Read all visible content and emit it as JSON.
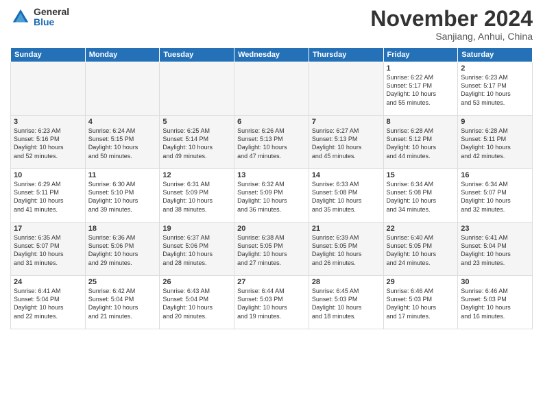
{
  "logo": {
    "general": "General",
    "blue": "Blue"
  },
  "title": "November 2024",
  "location": "Sanjiang, Anhui, China",
  "weekdays": [
    "Sunday",
    "Monday",
    "Tuesday",
    "Wednesday",
    "Thursday",
    "Friday",
    "Saturday"
  ],
  "weeks": [
    [
      {
        "day": "",
        "info": "",
        "empty": true
      },
      {
        "day": "",
        "info": "",
        "empty": true
      },
      {
        "day": "",
        "info": "",
        "empty": true
      },
      {
        "day": "",
        "info": "",
        "empty": true
      },
      {
        "day": "",
        "info": "",
        "empty": true
      },
      {
        "day": "1",
        "info": "Sunrise: 6:22 AM\nSunset: 5:17 PM\nDaylight: 10 hours\nand 55 minutes."
      },
      {
        "day": "2",
        "info": "Sunrise: 6:23 AM\nSunset: 5:17 PM\nDaylight: 10 hours\nand 53 minutes."
      }
    ],
    [
      {
        "day": "3",
        "info": "Sunrise: 6:23 AM\nSunset: 5:16 PM\nDaylight: 10 hours\nand 52 minutes."
      },
      {
        "day": "4",
        "info": "Sunrise: 6:24 AM\nSunset: 5:15 PM\nDaylight: 10 hours\nand 50 minutes."
      },
      {
        "day": "5",
        "info": "Sunrise: 6:25 AM\nSunset: 5:14 PM\nDaylight: 10 hours\nand 49 minutes."
      },
      {
        "day": "6",
        "info": "Sunrise: 6:26 AM\nSunset: 5:13 PM\nDaylight: 10 hours\nand 47 minutes."
      },
      {
        "day": "7",
        "info": "Sunrise: 6:27 AM\nSunset: 5:13 PM\nDaylight: 10 hours\nand 45 minutes."
      },
      {
        "day": "8",
        "info": "Sunrise: 6:28 AM\nSunset: 5:12 PM\nDaylight: 10 hours\nand 44 minutes."
      },
      {
        "day": "9",
        "info": "Sunrise: 6:28 AM\nSunset: 5:11 PM\nDaylight: 10 hours\nand 42 minutes."
      }
    ],
    [
      {
        "day": "10",
        "info": "Sunrise: 6:29 AM\nSunset: 5:11 PM\nDaylight: 10 hours\nand 41 minutes."
      },
      {
        "day": "11",
        "info": "Sunrise: 6:30 AM\nSunset: 5:10 PM\nDaylight: 10 hours\nand 39 minutes."
      },
      {
        "day": "12",
        "info": "Sunrise: 6:31 AM\nSunset: 5:09 PM\nDaylight: 10 hours\nand 38 minutes."
      },
      {
        "day": "13",
        "info": "Sunrise: 6:32 AM\nSunset: 5:09 PM\nDaylight: 10 hours\nand 36 minutes."
      },
      {
        "day": "14",
        "info": "Sunrise: 6:33 AM\nSunset: 5:08 PM\nDaylight: 10 hours\nand 35 minutes."
      },
      {
        "day": "15",
        "info": "Sunrise: 6:34 AM\nSunset: 5:08 PM\nDaylight: 10 hours\nand 34 minutes."
      },
      {
        "day": "16",
        "info": "Sunrise: 6:34 AM\nSunset: 5:07 PM\nDaylight: 10 hours\nand 32 minutes."
      }
    ],
    [
      {
        "day": "17",
        "info": "Sunrise: 6:35 AM\nSunset: 5:07 PM\nDaylight: 10 hours\nand 31 minutes."
      },
      {
        "day": "18",
        "info": "Sunrise: 6:36 AM\nSunset: 5:06 PM\nDaylight: 10 hours\nand 29 minutes."
      },
      {
        "day": "19",
        "info": "Sunrise: 6:37 AM\nSunset: 5:06 PM\nDaylight: 10 hours\nand 28 minutes."
      },
      {
        "day": "20",
        "info": "Sunrise: 6:38 AM\nSunset: 5:05 PM\nDaylight: 10 hours\nand 27 minutes."
      },
      {
        "day": "21",
        "info": "Sunrise: 6:39 AM\nSunset: 5:05 PM\nDaylight: 10 hours\nand 26 minutes."
      },
      {
        "day": "22",
        "info": "Sunrise: 6:40 AM\nSunset: 5:05 PM\nDaylight: 10 hours\nand 24 minutes."
      },
      {
        "day": "23",
        "info": "Sunrise: 6:41 AM\nSunset: 5:04 PM\nDaylight: 10 hours\nand 23 minutes."
      }
    ],
    [
      {
        "day": "24",
        "info": "Sunrise: 6:41 AM\nSunset: 5:04 PM\nDaylight: 10 hours\nand 22 minutes."
      },
      {
        "day": "25",
        "info": "Sunrise: 6:42 AM\nSunset: 5:04 PM\nDaylight: 10 hours\nand 21 minutes."
      },
      {
        "day": "26",
        "info": "Sunrise: 6:43 AM\nSunset: 5:04 PM\nDaylight: 10 hours\nand 20 minutes."
      },
      {
        "day": "27",
        "info": "Sunrise: 6:44 AM\nSunset: 5:03 PM\nDaylight: 10 hours\nand 19 minutes."
      },
      {
        "day": "28",
        "info": "Sunrise: 6:45 AM\nSunset: 5:03 PM\nDaylight: 10 hours\nand 18 minutes."
      },
      {
        "day": "29",
        "info": "Sunrise: 6:46 AM\nSunset: 5:03 PM\nDaylight: 10 hours\nand 17 minutes."
      },
      {
        "day": "30",
        "info": "Sunrise: 6:46 AM\nSunset: 5:03 PM\nDaylight: 10 hours\nand 16 minutes."
      }
    ]
  ]
}
